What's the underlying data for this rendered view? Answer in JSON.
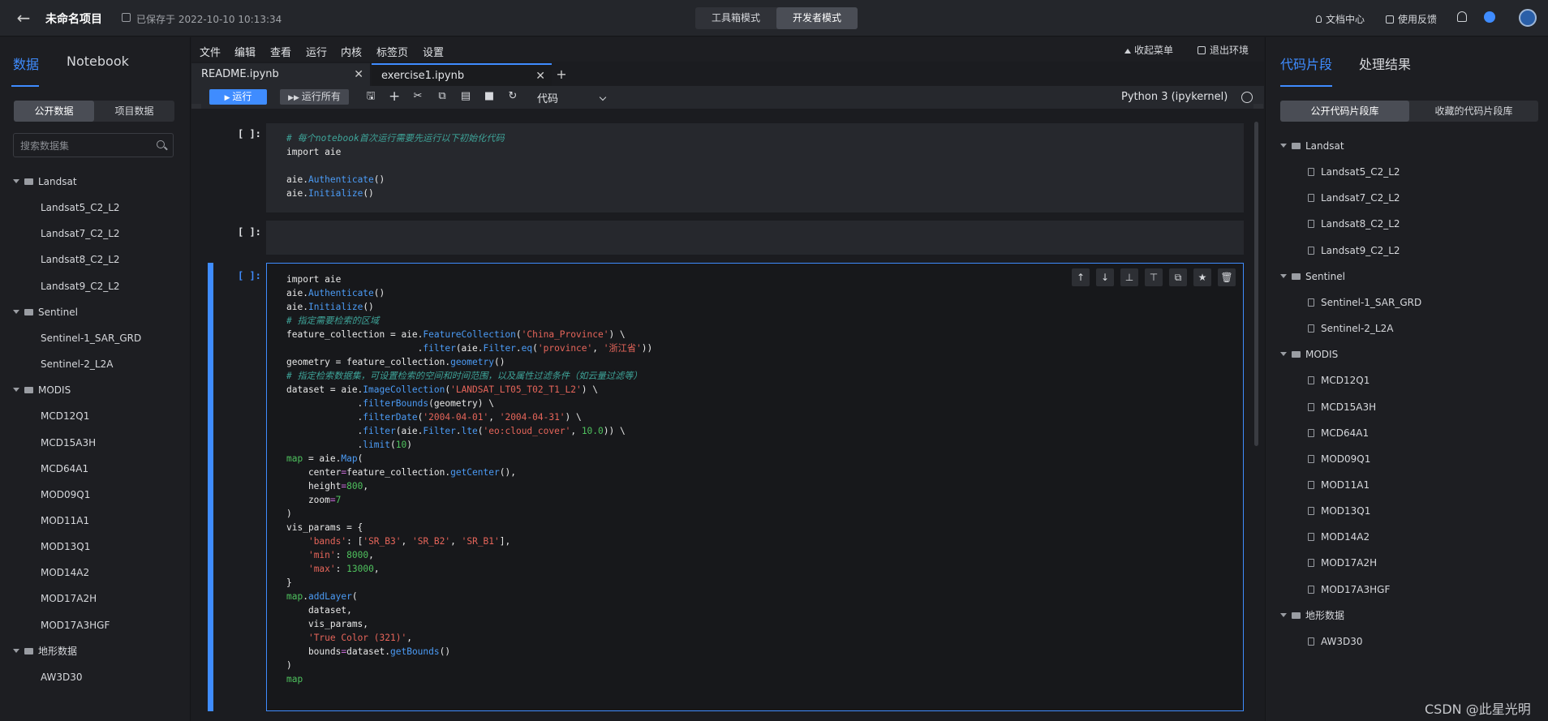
{
  "topbar": {
    "project_title": "未命名项目",
    "save_status": "已保存于 2022-10-10 10:13:34",
    "modes": [
      "工具箱模式",
      "开发者模式"
    ],
    "docs": "文档中心",
    "feedback": "使用反馈"
  },
  "left": {
    "tabs": [
      "数据",
      "Notebook"
    ],
    "segments": [
      "公开数据",
      "项目数据"
    ],
    "search_placeholder": "搜索数据集",
    "tree": [
      {
        "folder": "Landsat",
        "items": [
          "Landsat5_C2_L2",
          "Landsat7_C2_L2",
          "Landsat8_C2_L2",
          "Landsat9_C2_L2"
        ]
      },
      {
        "folder": "Sentinel",
        "items": [
          "Sentinel-1_SAR_GRD",
          "Sentinel-2_L2A"
        ]
      },
      {
        "folder": "MODIS",
        "items": [
          "MCD12Q1",
          "MCD15A3H",
          "MCD64A1",
          "MOD09Q1",
          "MOD11A1",
          "MOD13Q1",
          "MOD14A2",
          "MOD17A2H",
          "MOD17A3HGF"
        ]
      },
      {
        "folder": "地形数据",
        "items": [
          "AW3D30"
        ]
      }
    ]
  },
  "menubar": {
    "items": [
      "文件",
      "编辑",
      "查看",
      "运行",
      "内核",
      "标签页",
      "设置"
    ],
    "collapse": "收起菜单",
    "exit": "退出环境"
  },
  "tabs": {
    "readme": "README.ipynb",
    "exercise": "exercise1.ipynb"
  },
  "toolbar": {
    "run": "运行",
    "run_all": "运行所有",
    "cell_type": "代码",
    "kernel": "Python 3 (ipykernel)"
  },
  "cells": {
    "prompt": "[ ]:"
  },
  "right": {
    "tabs": [
      "代码片段",
      "处理结果"
    ],
    "segments": [
      "公开代码片段库",
      "收藏的代码片段库"
    ]
  },
  "watermark": "CSDN @此星光明"
}
